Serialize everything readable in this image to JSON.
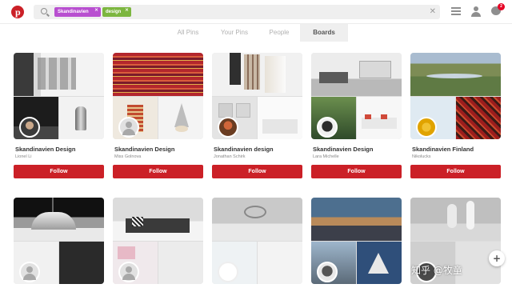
{
  "header": {
    "search": {
      "tags": [
        {
          "label": "Skandinavien",
          "color": "#b84fd0"
        },
        {
          "label": "design",
          "color": "#7cb63f"
        }
      ]
    },
    "notification_count": "2"
  },
  "tabs": [
    {
      "label": "All Pins",
      "active": false
    },
    {
      "label": "Your Pins",
      "active": false
    },
    {
      "label": "People",
      "active": false
    },
    {
      "label": "Boards",
      "active": true
    }
  ],
  "boards_row1": [
    {
      "title": "Skandinavien Design",
      "owner": "Lionel Li",
      "follow": "Follow"
    },
    {
      "title": "Skandinavien Design",
      "owner": "Miss Golnova",
      "follow": "Follow"
    },
    {
      "title": "Skandinavien design",
      "owner": "Jonathan Schirk",
      "follow": "Follow"
    },
    {
      "title": "Skandinavien Design",
      "owner": "Lara Michelle",
      "follow": "Follow"
    },
    {
      "title": "Skandinavien Finland",
      "owner": "Nikolucks",
      "follow": "Follow"
    }
  ],
  "watermark": "知乎 @牧童",
  "colors": {
    "accent": "#cb2027",
    "tab_active_bg": "#efefef"
  }
}
